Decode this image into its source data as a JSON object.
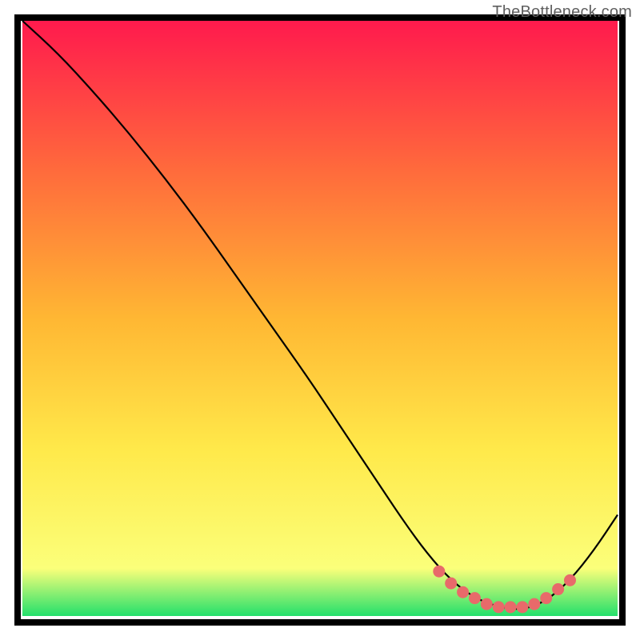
{
  "watermark": {
    "text": "TheBottleneck.com"
  },
  "colors": {
    "top": "#ff1a4d",
    "mid1": "#ff6a3c",
    "mid2": "#ffb733",
    "mid3": "#ffe94a",
    "mid4": "#fbff7a",
    "bottom": "#23e06b",
    "curve": "#000000",
    "dots": "#e86a6a",
    "border": "#000000"
  },
  "chart_data": {
    "type": "line",
    "title": "",
    "xlabel": "",
    "ylabel": "",
    "xlim": [
      0,
      100
    ],
    "ylim": [
      0,
      100
    ],
    "grid": false,
    "legend": false,
    "series": [
      {
        "name": "curve",
        "x": [
          0,
          6,
          12,
          18,
          24,
          30,
          36,
          42,
          48,
          54,
          60,
          64,
          68,
          72,
          76,
          80,
          84,
          88,
          92,
          96,
          100
        ],
        "y": [
          100,
          94.5,
          88,
          81,
          73.5,
          65.5,
          57,
          48.5,
          40,
          31,
          22,
          16,
          10.5,
          6,
          3,
          1.5,
          1,
          2.5,
          6,
          11,
          17
        ]
      },
      {
        "name": "optimal-dots",
        "x": [
          70,
          72,
          74,
          76,
          78,
          80,
          82,
          84,
          86,
          88,
          90,
          92
        ],
        "y": [
          7.5,
          5.5,
          4,
          3,
          2,
          1.5,
          1.5,
          1.5,
          2,
          3,
          4.5,
          6
        ]
      }
    ]
  }
}
